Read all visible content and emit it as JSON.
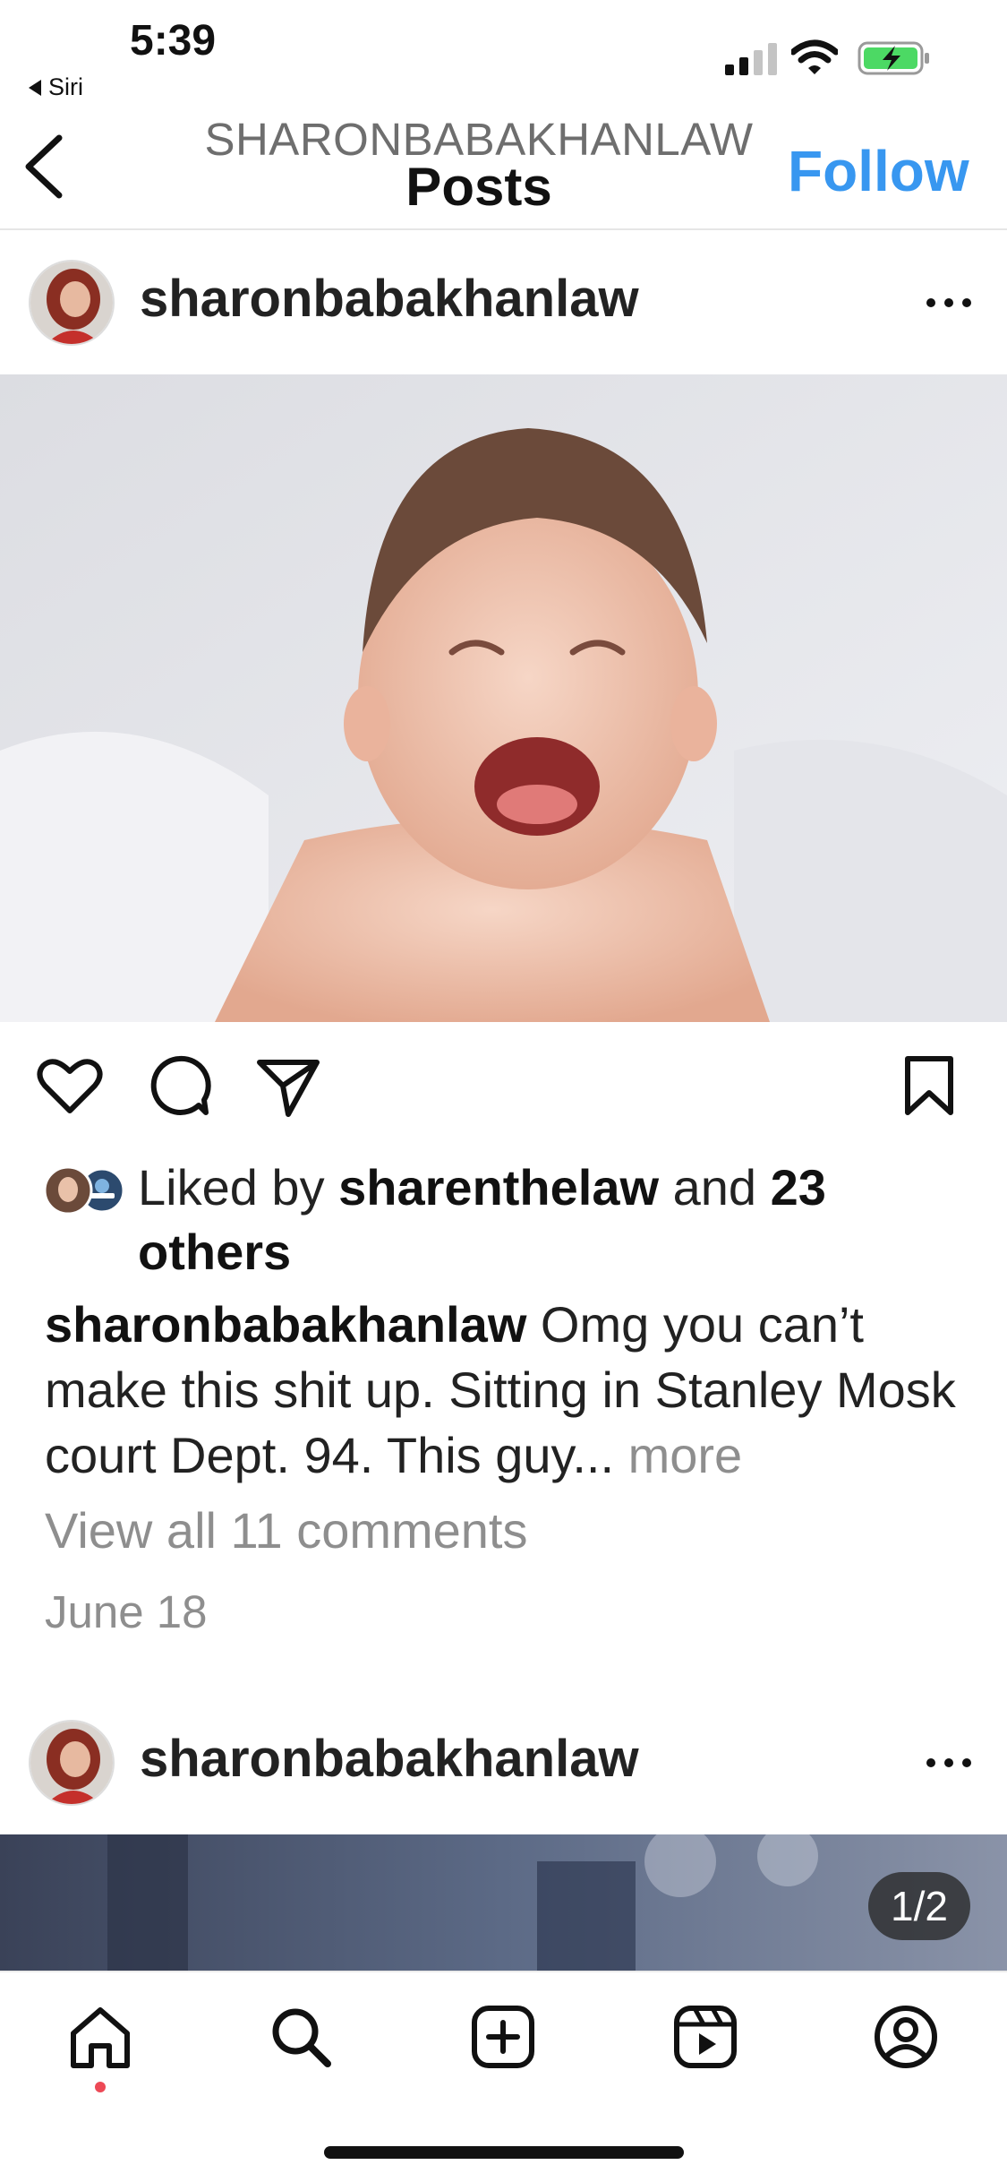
{
  "status_bar": {
    "time": "5:39",
    "back_app": "Siri",
    "battery_charging": true
  },
  "header": {
    "username": "SHARONBABAKHANLAW",
    "title": "Posts",
    "follow_label": "Follow",
    "icons": [
      "chevron-left-icon"
    ]
  },
  "post1": {
    "username": "sharonbabakhanlaw",
    "image_alt": "Laughing baby photo",
    "liked_prefix": "Liked by ",
    "liked_user": "sharenthelaw",
    "liked_mid": " and ",
    "liked_count": "23",
    "liked_suffix": "others",
    "caption_user": "sharonbabakhanlaw",
    "caption_text": " Omg you can’t make this shit up. Sitting in Stanley Mosk court Dept. 94. This guy... ",
    "caption_more": "more",
    "view_comments": "View all 11 comments",
    "date": "June 18",
    "actions": [
      "heart-icon",
      "comment-icon",
      "share-icon",
      "bookmark-icon"
    ]
  },
  "post2": {
    "username": "sharonbabakhanlaw",
    "carousel_indicator": "1/2"
  },
  "bottom_nav": {
    "items": [
      "home-icon",
      "search-icon",
      "create-icon",
      "reels-icon",
      "profile-icon"
    ],
    "notification_dot_color": "#ed4956"
  },
  "colors": {
    "accent": "#3897f0",
    "secondary_text": "#8e8e8e"
  }
}
